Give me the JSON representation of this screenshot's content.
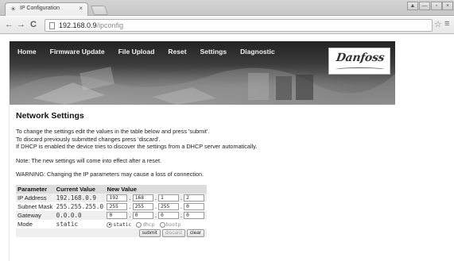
{
  "browser": {
    "tab_title": "IP Configuration",
    "tab_close": "×",
    "url_host": "192.168.0.9",
    "url_path": "/ipconfig",
    "back": "←",
    "forward": "→",
    "reload": "C",
    "star": "☆",
    "menu": "≡",
    "window_controls": [
      "▲",
      "—",
      "▫",
      "×"
    ]
  },
  "nav": {
    "items": [
      "Home",
      "Firmware Update",
      "File Upload",
      "Reset",
      "Settings",
      "Diagnostic"
    ]
  },
  "logo": {
    "text": "Danfoss"
  },
  "page": {
    "heading": "Network Settings",
    "intro_lines": [
      "To change the settings edit the values in the table below and press 'submit'.",
      "To discard previously submitted changes press 'discard'.",
      "If DHCP is enabled the device tries to discover the settings from a DHCP server automatically."
    ],
    "note": "Note: The new settings will come into effect after a reset.",
    "warning": "WARNING: Changing the IP parameters may cause a loss of connection."
  },
  "table": {
    "headers": [
      "Parameter",
      "Current Value",
      "New Value"
    ],
    "rows": [
      {
        "parameter": "IP Address",
        "current": "192.168.0.9",
        "octets": [
          "192",
          "168",
          "1",
          "2"
        ]
      },
      {
        "parameter": "Subnet Mask",
        "current": "255.255.255.0",
        "octets": [
          "255",
          "255",
          "255",
          "0"
        ]
      },
      {
        "parameter": "Gateway",
        "current": "0.0.0.0",
        "octets": [
          "0",
          "0",
          "0",
          "0"
        ]
      }
    ],
    "mode": {
      "parameter": "Mode",
      "current": "static",
      "options": [
        "static",
        "dhcp",
        "bootp"
      ],
      "selected": "static"
    },
    "buttons": {
      "submit": "submit",
      "discard": "discard",
      "clear": "clear"
    }
  }
}
